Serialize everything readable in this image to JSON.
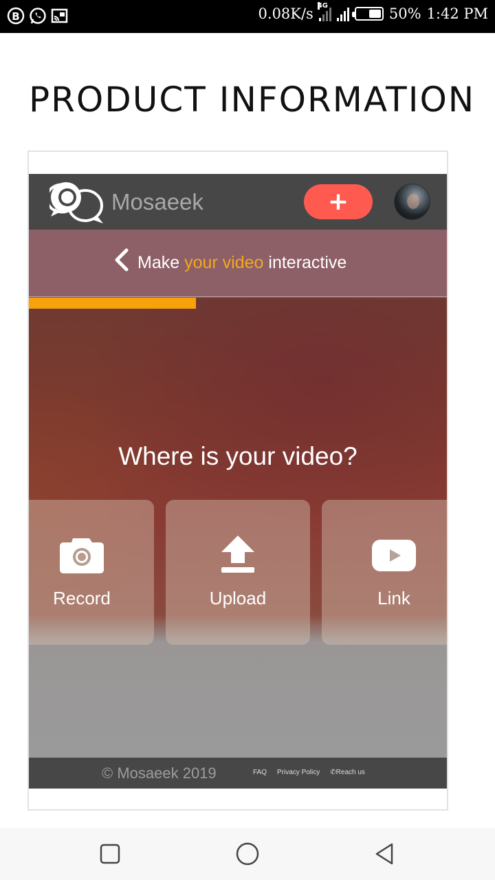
{
  "status_bar": {
    "net_speed": "0.08K/s",
    "network_type": "4G",
    "battery": "50%",
    "battery_level": 0.5,
    "time": "1:42 PM",
    "icons": [
      "b-app-icon",
      "whatsapp-icon",
      "cast-icon"
    ]
  },
  "page": {
    "title": "PRODUCT INFORMATION"
  },
  "app": {
    "brand": "Mosaeek",
    "add_button": "+",
    "header": {
      "prefix": "Make ",
      "accent": "your video",
      "suffix": " interactive"
    },
    "progress": 0.4,
    "accent_color": "#f7a20a",
    "add_color": "#ff5a4f",
    "question": "Where is your video?",
    "options": [
      {
        "label": "Record",
        "icon": "camera-icon"
      },
      {
        "label": "Upload",
        "icon": "upload-icon"
      },
      {
        "label": "Link",
        "icon": "youtube-icon"
      }
    ],
    "footer": {
      "copyright": "© Mosaeek 2019",
      "links": [
        "FAQ",
        "Privacy Policy",
        "Reach us"
      ]
    }
  },
  "nav_bar": {
    "buttons": [
      "recents-button",
      "home-button",
      "back-button"
    ]
  }
}
